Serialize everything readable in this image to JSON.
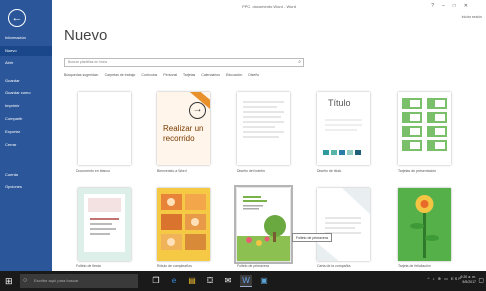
{
  "window": {
    "title": "PPC. documento Word - Word",
    "controls": [
      "?",
      "–",
      "□",
      "✕"
    ],
    "signin": "Iniciar sesión"
  },
  "sidebar": {
    "back_icon": "back-arrow-icon",
    "items": [
      {
        "label": "Información",
        "active": false
      },
      {
        "label": "Nuevo",
        "active": true
      },
      {
        "label": "Abrir",
        "active": false
      },
      {
        "label": "Guardar",
        "active": false
      },
      {
        "label": "Guardar como",
        "active": false
      },
      {
        "label": "Imprimir",
        "active": false
      },
      {
        "label": "Compartir",
        "active": false
      },
      {
        "label": "Exportar",
        "active": false
      },
      {
        "label": "Cerrar",
        "active": false
      },
      {
        "label": "Cuenta",
        "active": false
      },
      {
        "label": "Opciones",
        "active": false
      }
    ]
  },
  "main": {
    "heading": "Nuevo",
    "search_placeholder": "Buscar plantillas en línea",
    "search_icon": "search-icon",
    "suggested_label": "Búsquedas sugeridas:",
    "suggested": [
      "Carpetas de trabajo",
      "Currículos",
      "Personal",
      "Tarjetas",
      "Calendarios",
      "Educación",
      "Diseño"
    ]
  },
  "templates": [
    {
      "caption": "Documento en blanco",
      "type": "blank"
    },
    {
      "caption": "Bienvenido a Word",
      "type": "tour",
      "text": "Realizar un recorrido"
    },
    {
      "caption": "Diseño del boletín",
      "type": "lines"
    },
    {
      "caption": "Diseño de título",
      "type": "title",
      "text": "Título"
    },
    {
      "caption": "Tarjetas de presentación",
      "type": "cards"
    },
    {
      "caption": "Folleto de fiesta",
      "type": "flyer"
    },
    {
      "caption": "Rótulo de cumpleaños",
      "type": "photos"
    },
    {
      "caption": "Folleto de primavera",
      "type": "spring",
      "text": "Folleto de primavera"
    },
    {
      "caption": "Carta de la compañía",
      "type": "letter"
    },
    {
      "caption": "Tarjeta de felicitación",
      "type": "flower"
    }
  ],
  "tooltip": "Folleto de primavera",
  "taskbar": {
    "search_placeholder": "Escribe aquí para buscar",
    "start_icon": "windows-start-icon",
    "apps": [
      "task-view-icon",
      "edge-browser-icon",
      "file-explorer-icon",
      "store-icon",
      "mail-icon",
      "word-icon",
      "photos-icon"
    ],
    "tray": "^ ♪ ⊕ ▭ ESP",
    "time": "9:20 a. m.",
    "date": "5/5/2017"
  }
}
